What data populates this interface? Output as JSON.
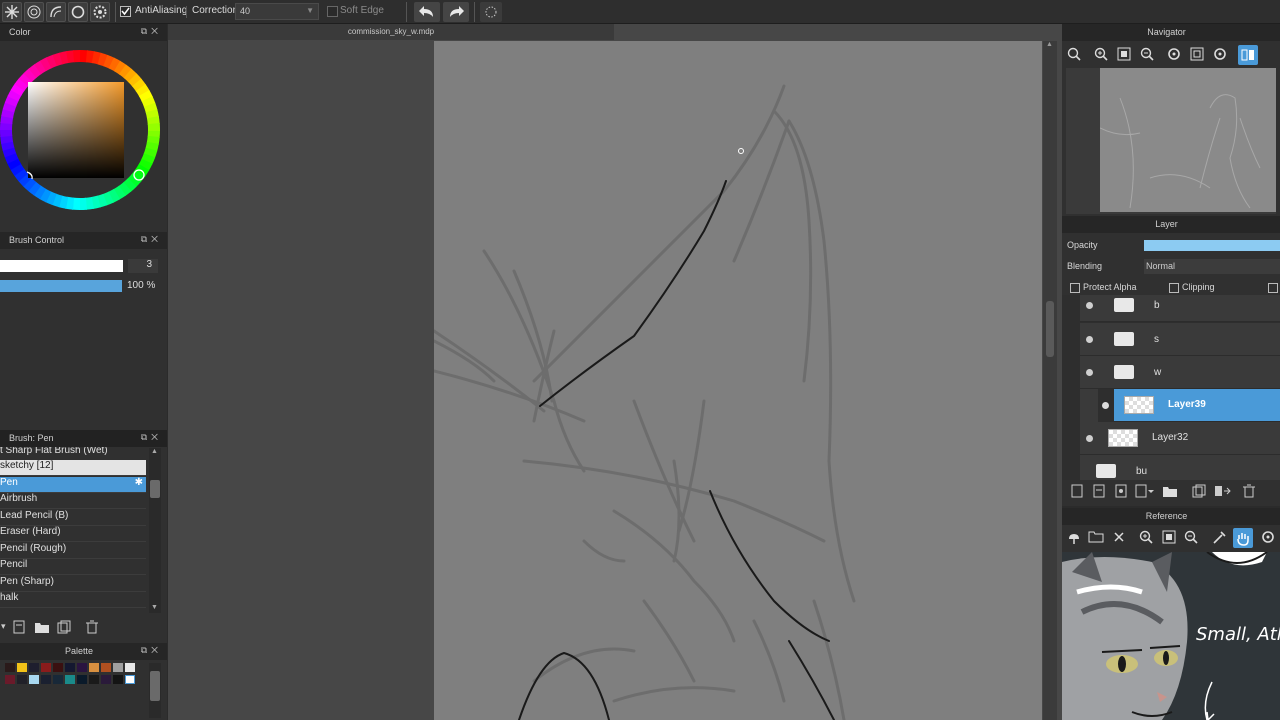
{
  "toolbar": {
    "antialiasing_label": "AntiAliasing",
    "correction_label": "Correction",
    "correction_value": "40",
    "soft_edge_label": "Soft Edge"
  },
  "document": {
    "tab_title": "commission_sky_w.mdp"
  },
  "color_panel": {
    "title": "Color"
  },
  "brush_control": {
    "title": "Brush Control",
    "size_value": "3",
    "opacity_value": "100 %"
  },
  "brush_panel": {
    "title": "Brush: Pen",
    "items": [
      {
        "label": "t Sharp Flat Brush (Wet)"
      },
      {
        "label": "sketchy [12]"
      },
      {
        "label": "Pen"
      },
      {
        "label": "Airbrush"
      },
      {
        "label": "Lead Pencil (B)"
      },
      {
        "label": "Eraser (Hard)"
      },
      {
        "label": "Pencil (Rough)"
      },
      {
        "label": "Pencil"
      },
      {
        "label": "Pen (Sharp)"
      },
      {
        "label": "halk"
      }
    ]
  },
  "palette_panel": {
    "title": "Palette"
  },
  "navigator": {
    "title": "Navigator"
  },
  "layer_panel": {
    "title": "Layer",
    "opacity_label": "Opacity",
    "blending_label": "Blending",
    "blending_value": "Normal",
    "protect_alpha_label": "Protect Alpha",
    "clipping_label": "Clipping",
    "layers": [
      {
        "name": "b",
        "type": "folder"
      },
      {
        "name": "s",
        "type": "folder"
      },
      {
        "name": "w",
        "type": "folder"
      },
      {
        "name": "Layer39",
        "type": "layer",
        "selected": true
      },
      {
        "name": "Layer32",
        "type": "layer"
      },
      {
        "name": "bu",
        "type": "folder"
      }
    ]
  },
  "reference": {
    "title": "Reference",
    "image_text": "Small, Ath"
  },
  "colors": {
    "accent": "#4a9ad8",
    "panel": "#303030",
    "paper": "#7f7f7f"
  }
}
